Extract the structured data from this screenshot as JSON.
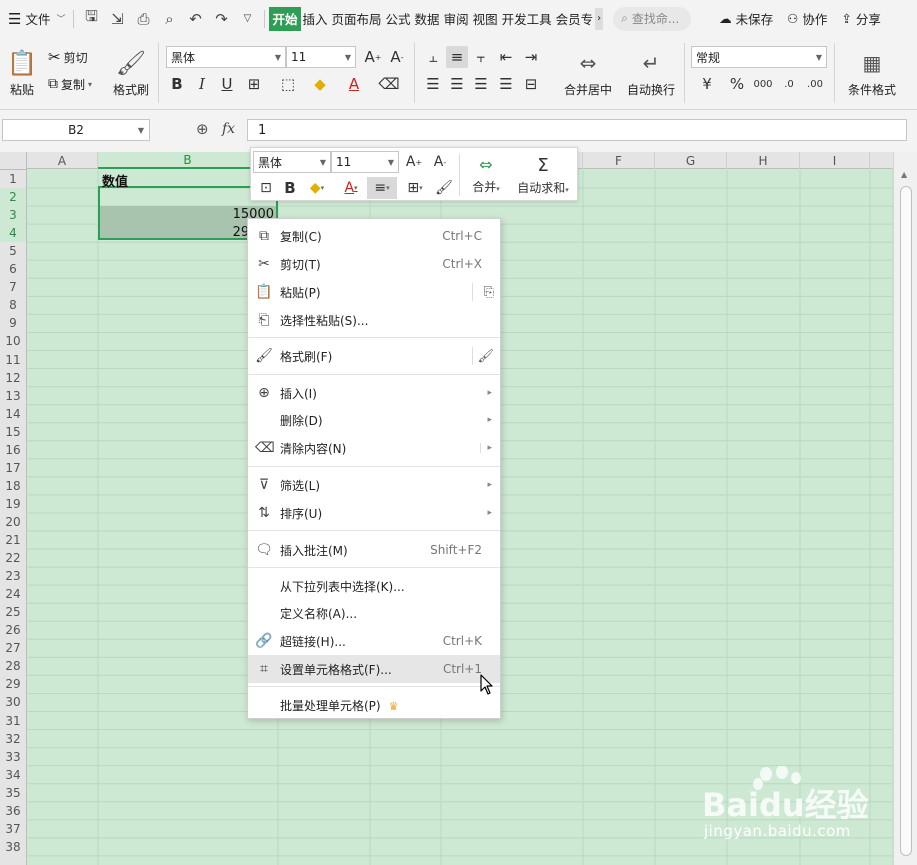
{
  "menubar": {
    "file_label": "文件",
    "tabs": [
      "开始",
      "插入",
      "页面布局",
      "公式",
      "数据",
      "审阅",
      "视图",
      "开发工具",
      "会员专"
    ],
    "active_tab": "开始",
    "search_placeholder": "查找命...",
    "unsaved_label": "未保存",
    "collab_label": "协作",
    "share_label": "分享"
  },
  "ribbon": {
    "paste_label": "粘贴",
    "cut_label": "剪切",
    "copy_label": "复制",
    "format_painter_label": "格式刷",
    "font_name": "黑体",
    "font_size": "11",
    "merge_center_label": "合并居中",
    "wrap_text_label": "自动换行",
    "number_format": "常规",
    "conditional_format_label": "条件格式"
  },
  "formula_bar": {
    "cell_ref": "B2",
    "fx_label": "fx",
    "value": "1"
  },
  "grid": {
    "columns": [
      "A",
      "B",
      "C",
      "D",
      "E",
      "F",
      "G",
      "H",
      "I"
    ],
    "rows": [
      "1",
      "2",
      "3",
      "4",
      "5",
      "6",
      "7",
      "8",
      "9",
      "10",
      "11",
      "12",
      "13",
      "14",
      "15",
      "16",
      "17",
      "18",
      "19",
      "20",
      "21",
      "22",
      "23",
      "24",
      "25",
      "26",
      "27",
      "28",
      "29",
      "30",
      "31",
      "32",
      "33",
      "34",
      "35",
      "36",
      "37",
      "38"
    ],
    "cells": {
      "B1": "数值",
      "B3": "15000",
      "B4": "29984"
    }
  },
  "mini_toolbar": {
    "font_name": "黑体",
    "font_size": "11",
    "merge_label": "合并",
    "autosum_label": "自动求和"
  },
  "context_menu": {
    "items": [
      {
        "icon": "copy-icon",
        "label": "复制(C)",
        "shortcut": "Ctrl+C"
      },
      {
        "icon": "cut-icon",
        "label": "剪切(T)",
        "shortcut": "Ctrl+X"
      },
      {
        "icon": "paste-icon",
        "label": "粘贴(P)"
      },
      {
        "icon": "paste-special-icon",
        "label": "选择性粘贴(S)..."
      },
      {
        "icon": "format-painter-icon",
        "label": "格式刷(F)"
      },
      {
        "icon": "insert-icon",
        "label": "插入(I)"
      },
      {
        "icon": "",
        "label": "删除(D)"
      },
      {
        "icon": "clear-icon",
        "label": "清除内容(N)"
      },
      {
        "icon": "filter-icon",
        "label": "筛选(L)"
      },
      {
        "icon": "sort-icon",
        "label": "排序(U)"
      },
      {
        "icon": "comment-icon",
        "label": "插入批注(M)",
        "shortcut": "Shift+F2"
      },
      {
        "icon": "",
        "label": "从下拉列表中选择(K)..."
      },
      {
        "icon": "",
        "label": "定义名称(A)..."
      },
      {
        "icon": "link-icon",
        "label": "超链接(H)...",
        "shortcut": "Ctrl+K"
      },
      {
        "icon": "format-cells-icon",
        "label": "设置单元格格式(F)...",
        "shortcut": "Ctrl+1"
      },
      {
        "icon": "",
        "label": "批量处理单元格(P)"
      }
    ],
    "highlighted": "设置单元格格式(F)..."
  },
  "watermark": {
    "brand": "Baidu经验",
    "url": "jingyan.baidu.com"
  },
  "colors": {
    "accent_green": "#2f9e55",
    "grid_bg": "#cde8d3",
    "selection_fill": "#a9c4ae"
  }
}
